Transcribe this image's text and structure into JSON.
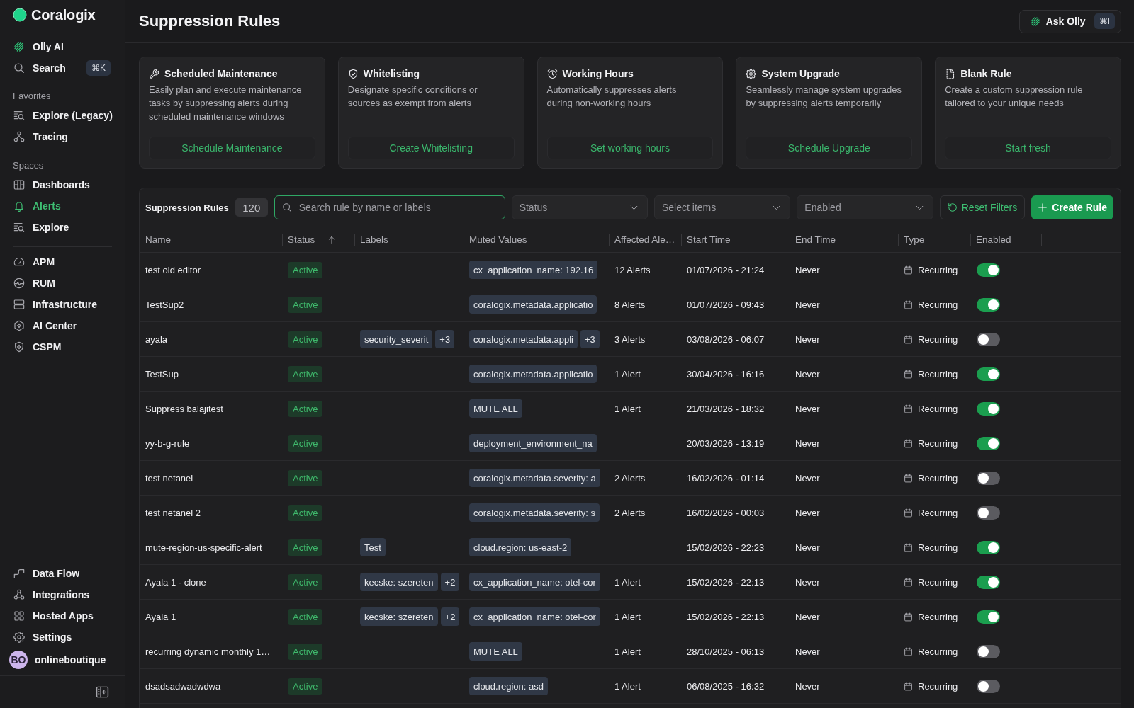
{
  "sidebar": {
    "logo": "Coralogix",
    "top_items": [
      {
        "label": "Olly AI",
        "selected": false
      },
      {
        "label": "Search",
        "shortcut": "⌘K",
        "selected": false
      }
    ],
    "favorites": {
      "title": "Favorites",
      "items": [
        {
          "label": "Explore (Legacy)",
          "selected": false
        },
        {
          "label": "Tracing",
          "selected": false
        }
      ]
    },
    "spaces": {
      "title": "Spaces",
      "items": [
        {
          "label": "Dashboards",
          "selected": false
        },
        {
          "label": "Alerts",
          "selected": true
        },
        {
          "label": "Explore",
          "selected": false
        }
      ]
    },
    "products": [
      {
        "label": "APM",
        "selected": false
      },
      {
        "label": "RUM",
        "selected": false
      },
      {
        "label": "Infrastructure",
        "selected": false
      },
      {
        "label": "AI Center",
        "selected": false
      },
      {
        "label": "CSPM",
        "selected": false
      }
    ],
    "bottom_items": [
      {
        "label": "Data Flow",
        "selected": false
      },
      {
        "label": "Integrations",
        "selected": false
      },
      {
        "label": "Hosted Apps",
        "selected": false
      },
      {
        "label": "Settings",
        "selected": false
      }
    ],
    "user": {
      "initials": "BO",
      "name": "onlineboutique"
    }
  },
  "header": {
    "title": "Suppression Rules",
    "ask_button": {
      "label": "Ask Olly",
      "shortcut": "⌘I"
    }
  },
  "templates": [
    {
      "title": "Scheduled Maintenance",
      "description": "Easily plan and execute maintenance tasks by suppressing alerts during scheduled maintenance windows",
      "action": "Schedule Maintenance"
    },
    {
      "title": "Whitelisting",
      "description": "Designate specific conditions or sources as exempt from alerts",
      "action": "Create Whitelisting"
    },
    {
      "title": "Working Hours",
      "description": "Automatically suppresses alerts during non-working hours",
      "action": "Set working hours"
    },
    {
      "title": "System Upgrade",
      "description": "Seamlessly manage system upgrades by suppressing alerts temporarily",
      "action": "Schedule Upgrade"
    },
    {
      "title": "Blank Rule",
      "description": "Create a custom suppression rule tailored to your unique needs",
      "action": "Start fresh"
    }
  ],
  "rules_table": {
    "title": "Suppression Rules",
    "count": "120",
    "search": {
      "placeholder": "Search rule by name or labels",
      "focused": true
    },
    "filters": [
      {
        "placeholder": "Status"
      },
      {
        "placeholder": "Select items"
      },
      {
        "placeholder": "Enabled"
      }
    ],
    "reset_button": "Reset Filters",
    "create_button": "Create Rule",
    "columns": [
      {
        "label": "Name",
        "sorted": false
      },
      {
        "label": "Status",
        "sorted": true
      },
      {
        "label": "Labels",
        "sorted": false
      },
      {
        "label": "Muted Values",
        "sorted": false
      },
      {
        "label": "Affected Ale…",
        "sorted": false
      },
      {
        "label": "Start Time",
        "sorted": false
      },
      {
        "label": "End Time",
        "sorted": false
      },
      {
        "label": "Type",
        "sorted": false
      },
      {
        "label": "Enabled",
        "sorted": false
      }
    ],
    "rows": [
      {
        "name": "test old editor",
        "status": "Active",
        "muted_values": [
          "cx_application_name: 192.16"
        ],
        "affected": "12 Alerts",
        "start_time": "01/07/2026 - 21:24",
        "end_time": "Never",
        "type": "Recurring",
        "enabled": true
      },
      {
        "name": "TestSup2",
        "status": "Active",
        "muted_values": [
          "coralogix.metadata.applicatio"
        ],
        "affected": "8 Alerts",
        "start_time": "01/07/2026 - 09:43",
        "end_time": "Never",
        "type": "Recurring",
        "enabled": true
      },
      {
        "name": "ayala",
        "status": "Active",
        "labels": [
          "security_severit"
        ],
        "labels_more": "+3",
        "muted_values": [
          "coralogix.metadata.appli"
        ],
        "muted_more": "+3",
        "affected": "3 Alerts",
        "start_time": "03/08/2026 - 06:07",
        "end_time": "Never",
        "type": "Recurring",
        "enabled": false
      },
      {
        "name": "TestSup",
        "status": "Active",
        "muted_values": [
          "coralogix.metadata.applicatio"
        ],
        "affected": "1 Alert",
        "start_time": "30/04/2026 - 16:16",
        "end_time": "Never",
        "type": "Recurring",
        "enabled": true
      },
      {
        "name": "Suppress balajitest",
        "status": "Active",
        "muted_values": [
          "MUTE ALL"
        ],
        "affected": "1 Alert",
        "start_time": "21/03/2026 - 18:32",
        "end_time": "Never",
        "type": "Recurring",
        "enabled": true
      },
      {
        "name": "yy-b-g-rule",
        "status": "Active",
        "muted_values": [
          "deployment_environment_na"
        ],
        "start_time": "20/03/2026 - 13:19",
        "end_time": "Never",
        "type": "Recurring",
        "enabled": true
      },
      {
        "name": "test netanel",
        "status": "Active",
        "muted_values": [
          "coralogix.metadata.severity: a"
        ],
        "affected": "2 Alerts",
        "start_time": "16/02/2026 - 01:14",
        "end_time": "Never",
        "type": "Recurring",
        "enabled": false
      },
      {
        "name": "test netanel 2",
        "status": "Active",
        "muted_values": [
          "coralogix.metadata.severity: s"
        ],
        "affected": "2 Alerts",
        "start_time": "16/02/2026 - 00:03",
        "end_time": "Never",
        "type": "Recurring",
        "enabled": false
      },
      {
        "name": "mute-region-us-specific-alert",
        "status": "Active",
        "labels": [
          "Test"
        ],
        "muted_values": [
          "cloud.region: us-east-2"
        ],
        "start_time": "15/02/2026 - 22:23",
        "end_time": "Never",
        "type": "Recurring",
        "enabled": true
      },
      {
        "name": "Ayala 1 - clone",
        "status": "Active",
        "labels": [
          "kecske: szereten"
        ],
        "labels_more": "+2",
        "muted_values": [
          "cx_application_name: otel-cor"
        ],
        "affected": "1 Alert",
        "start_time": "15/02/2026 - 22:13",
        "end_time": "Never",
        "type": "Recurring",
        "enabled": true
      },
      {
        "name": "Ayala 1",
        "status": "Active",
        "labels": [
          "kecske: szereten"
        ],
        "labels_more": "+2",
        "muted_values": [
          "cx_application_name: otel-cor"
        ],
        "affected": "1 Alert",
        "start_time": "15/02/2026 - 22:13",
        "end_time": "Never",
        "type": "Recurring",
        "enabled": true
      },
      {
        "name": "recurring dynamic monthly 1…",
        "status": "Active",
        "muted_values": [
          "MUTE ALL"
        ],
        "affected": "1 Alert",
        "start_time": "28/10/2025 - 06:13",
        "end_time": "Never",
        "type": "Recurring",
        "enabled": false
      },
      {
        "name": "dsadsadwadwdwa",
        "status": "Active",
        "muted_values": [
          "cloud.region: asd"
        ],
        "affected": "1 Alert",
        "start_time": "06/08/2025 - 16:32",
        "end_time": "Never",
        "type": "Recurring",
        "enabled": false
      }
    ]
  }
}
